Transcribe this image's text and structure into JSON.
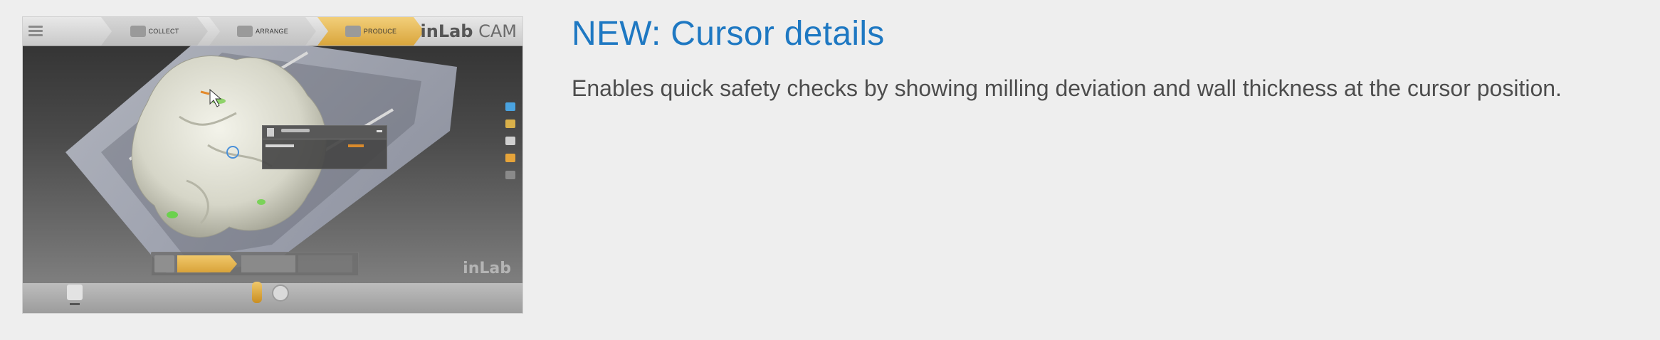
{
  "screenshot": {
    "alt": "inLab CAM software screen showing milling cursor details on a crown",
    "steps": [
      {
        "label": "COLLECT",
        "icon": "collect-icon"
      },
      {
        "label": "ARRANGE",
        "icon": "arrange-icon"
      },
      {
        "label": "PRODUCE",
        "icon": "produce-icon"
      }
    ],
    "brand": {
      "bold": "inLab",
      "regular": " CAM"
    },
    "watermark": "inLab",
    "accent_color": "#d9a53c"
  },
  "content": {
    "title": "NEW: Cursor details",
    "description": "Enables quick safety checks by showing milling deviation and wall thickness at the cursor position.",
    "title_color": "#1e78c2",
    "text_color": "#4d4d4d"
  }
}
